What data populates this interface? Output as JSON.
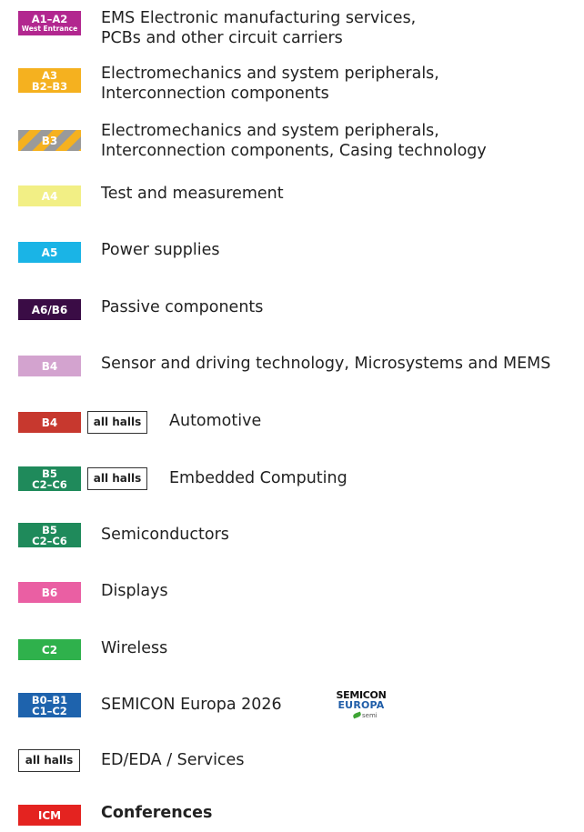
{
  "legend": [
    {
      "badge": [
        "A1–A2",
        "West Entrance"
      ],
      "color": "#b2278f",
      "text": [
        "EMS Electronic manufacturing services,",
        "PCBs and other circuit carriers"
      ]
    },
    {
      "badge": [
        "A3",
        "B2–B3"
      ],
      "color": "#f5b11f",
      "text": [
        "Electromechanics and system peripherals,",
        "Interconnection components"
      ]
    },
    {
      "badge": [
        "B3"
      ],
      "color": "#f5b11f",
      "stripe": "#9a9a9a",
      "text": [
        "Electromechanics and system peripherals,",
        "Interconnection components, Casing technology"
      ]
    },
    {
      "badge": [
        "A4"
      ],
      "color": "#f2ef85",
      "text_color": "#ffffff",
      "text": [
        "Test and measurement"
      ]
    },
    {
      "badge": [
        "A5"
      ],
      "color": "#1ab4e6",
      "text": [
        "Power supplies"
      ]
    },
    {
      "badge": [
        "A6/B6"
      ],
      "color": "#3a0c45",
      "text": [
        "Passive components"
      ]
    },
    {
      "badge": [
        "B4"
      ],
      "color": "#d3a3cf",
      "text": [
        "Sensor and driving technology, Microsystems and MEMS"
      ]
    },
    {
      "badge": [
        "B4"
      ],
      "color": "#c7382e",
      "all_halls": "all halls",
      "text": [
        "Automotive"
      ]
    },
    {
      "badge": [
        "B5",
        "C2–C6"
      ],
      "color": "#1f8a5b",
      "all_halls": "all halls",
      "text": [
        "Embedded Computing"
      ]
    },
    {
      "badge": [
        "B5",
        "C2–C6"
      ],
      "color": "#1f8a5b",
      "text": [
        "Semiconductors"
      ]
    },
    {
      "badge": [
        "B6"
      ],
      "color": "#ea5fa3",
      "text": [
        "Displays"
      ]
    },
    {
      "badge": [
        "C2"
      ],
      "color": "#2fb14c",
      "text": [
        "Wireless"
      ]
    },
    {
      "badge": [
        "B0–B1",
        "C1–C2"
      ],
      "color": "#1e63ad",
      "text": [
        "SEMICON Europa 2026"
      ],
      "logo": {
        "line1": "SEMICON",
        "line2": "EUROPA",
        "line3": "semi"
      }
    },
    {
      "all_halls_only": "all halls",
      "text": [
        "ED/EDA  /  Services"
      ]
    },
    {
      "badge": [
        "ICM"
      ],
      "color": "#e42320",
      "bold": true,
      "text": [
        "Conferences"
      ]
    }
  ]
}
